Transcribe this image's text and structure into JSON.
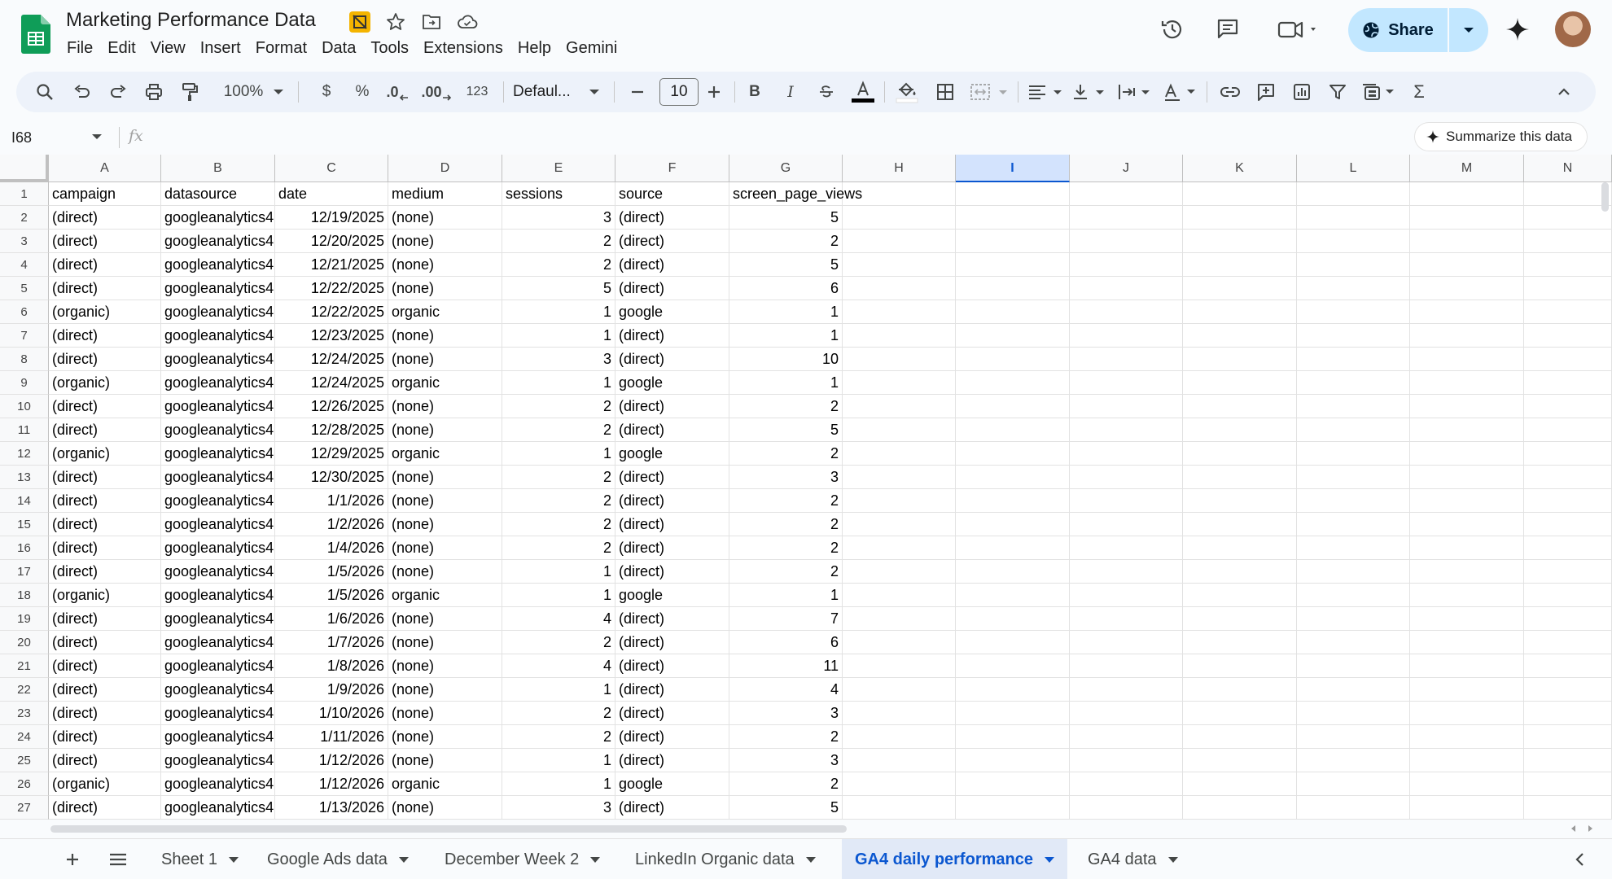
{
  "document": {
    "title": "Marketing Performance Data"
  },
  "menu": [
    "File",
    "Edit",
    "View",
    "Insert",
    "Format",
    "Data",
    "Tools",
    "Extensions",
    "Help",
    "Gemini"
  ],
  "header": {
    "share_label": "Share"
  },
  "toolbar": {
    "zoom": "100%",
    "currency": "$",
    "percent": "%",
    "dec_decrease": ".0",
    "dec_increase": ".00",
    "number_format": "123",
    "font": "Defaul...",
    "font_size": "10",
    "bold": "B",
    "italic": "I",
    "sigma": "Σ"
  },
  "formula_bar": {
    "cell_ref": "I68",
    "fx": "fx",
    "summarize_label": "Summarize this data"
  },
  "grid": {
    "columns": [
      "A",
      "B",
      "C",
      "D",
      "E",
      "F",
      "G",
      "H",
      "I",
      "J",
      "K",
      "L",
      "M",
      "N"
    ],
    "selected_column": "I",
    "rows": [
      {
        "n": "1",
        "cells": [
          "campaign",
          "datasource",
          "date",
          "medium",
          "sessions",
          "source",
          "screen_page_views"
        ]
      },
      {
        "n": "2",
        "cells": [
          "(direct)",
          "googleanalytics4",
          "12/19/2025",
          "(none)",
          "3",
          "(direct)",
          "5"
        ]
      },
      {
        "n": "3",
        "cells": [
          "(direct)",
          "googleanalytics4",
          "12/20/2025",
          "(none)",
          "2",
          "(direct)",
          "2"
        ]
      },
      {
        "n": "4",
        "cells": [
          "(direct)",
          "googleanalytics4",
          "12/21/2025",
          "(none)",
          "2",
          "(direct)",
          "5"
        ]
      },
      {
        "n": "5",
        "cells": [
          "(direct)",
          "googleanalytics4",
          "12/22/2025",
          "(none)",
          "5",
          "(direct)",
          "6"
        ]
      },
      {
        "n": "6",
        "cells": [
          "(organic)",
          "googleanalytics4",
          "12/22/2025",
          "organic",
          "1",
          "google",
          "1"
        ]
      },
      {
        "n": "7",
        "cells": [
          "(direct)",
          "googleanalytics4",
          "12/23/2025",
          "(none)",
          "1",
          "(direct)",
          "1"
        ]
      },
      {
        "n": "8",
        "cells": [
          "(direct)",
          "googleanalytics4",
          "12/24/2025",
          "(none)",
          "3",
          "(direct)",
          "10"
        ]
      },
      {
        "n": "9",
        "cells": [
          "(organic)",
          "googleanalytics4",
          "12/24/2025",
          "organic",
          "1",
          "google",
          "1"
        ]
      },
      {
        "n": "10",
        "cells": [
          "(direct)",
          "googleanalytics4",
          "12/26/2025",
          "(none)",
          "2",
          "(direct)",
          "2"
        ]
      },
      {
        "n": "11",
        "cells": [
          "(direct)",
          "googleanalytics4",
          "12/28/2025",
          "(none)",
          "2",
          "(direct)",
          "5"
        ]
      },
      {
        "n": "12",
        "cells": [
          "(organic)",
          "googleanalytics4",
          "12/29/2025",
          "organic",
          "1",
          "google",
          "2"
        ]
      },
      {
        "n": "13",
        "cells": [
          "(direct)",
          "googleanalytics4",
          "12/30/2025",
          "(none)",
          "2",
          "(direct)",
          "3"
        ]
      },
      {
        "n": "14",
        "cells": [
          "(direct)",
          "googleanalytics4",
          "1/1/2026",
          "(none)",
          "2",
          "(direct)",
          "2"
        ]
      },
      {
        "n": "15",
        "cells": [
          "(direct)",
          "googleanalytics4",
          "1/2/2026",
          "(none)",
          "2",
          "(direct)",
          "2"
        ]
      },
      {
        "n": "16",
        "cells": [
          "(direct)",
          "googleanalytics4",
          "1/4/2026",
          "(none)",
          "2",
          "(direct)",
          "2"
        ]
      },
      {
        "n": "17",
        "cells": [
          "(direct)",
          "googleanalytics4",
          "1/5/2026",
          "(none)",
          "1",
          "(direct)",
          "2"
        ]
      },
      {
        "n": "18",
        "cells": [
          "(organic)",
          "googleanalytics4",
          "1/5/2026",
          "organic",
          "1",
          "google",
          "1"
        ]
      },
      {
        "n": "19",
        "cells": [
          "(direct)",
          "googleanalytics4",
          "1/6/2026",
          "(none)",
          "4",
          "(direct)",
          "7"
        ]
      },
      {
        "n": "20",
        "cells": [
          "(direct)",
          "googleanalytics4",
          "1/7/2026",
          "(none)",
          "2",
          "(direct)",
          "6"
        ]
      },
      {
        "n": "21",
        "cells": [
          "(direct)",
          "googleanalytics4",
          "1/8/2026",
          "(none)",
          "4",
          "(direct)",
          "11"
        ]
      },
      {
        "n": "22",
        "cells": [
          "(direct)",
          "googleanalytics4",
          "1/9/2026",
          "(none)",
          "1",
          "(direct)",
          "4"
        ]
      },
      {
        "n": "23",
        "cells": [
          "(direct)",
          "googleanalytics4",
          "1/10/2026",
          "(none)",
          "2",
          "(direct)",
          "3"
        ]
      },
      {
        "n": "24",
        "cells": [
          "(direct)",
          "googleanalytics4",
          "1/11/2026",
          "(none)",
          "2",
          "(direct)",
          "2"
        ]
      },
      {
        "n": "25",
        "cells": [
          "(direct)",
          "googleanalytics4",
          "1/12/2026",
          "(none)",
          "1",
          "(direct)",
          "3"
        ]
      },
      {
        "n": "26",
        "cells": [
          "(organic)",
          "googleanalytics4",
          "1/12/2026",
          "organic",
          "1",
          "google",
          "2"
        ]
      },
      {
        "n": "27",
        "cells": [
          "(direct)",
          "googleanalytics4",
          "1/13/2026",
          "(none)",
          "3",
          "(direct)",
          "5"
        ]
      }
    ]
  },
  "tabs": [
    {
      "label": "Sheet 1",
      "active": false
    },
    {
      "label": "Google Ads data",
      "active": false
    },
    {
      "label": "December Week 2",
      "active": false
    },
    {
      "label": "LinkedIn Organic data",
      "active": false
    },
    {
      "label": "GA4 daily performance",
      "active": true
    },
    {
      "label": "GA4 data",
      "active": false
    }
  ],
  "colors": {
    "accent": "#0b57d0",
    "share_bg": "#c2e7ff",
    "sheets_green": "#0f9d58"
  }
}
